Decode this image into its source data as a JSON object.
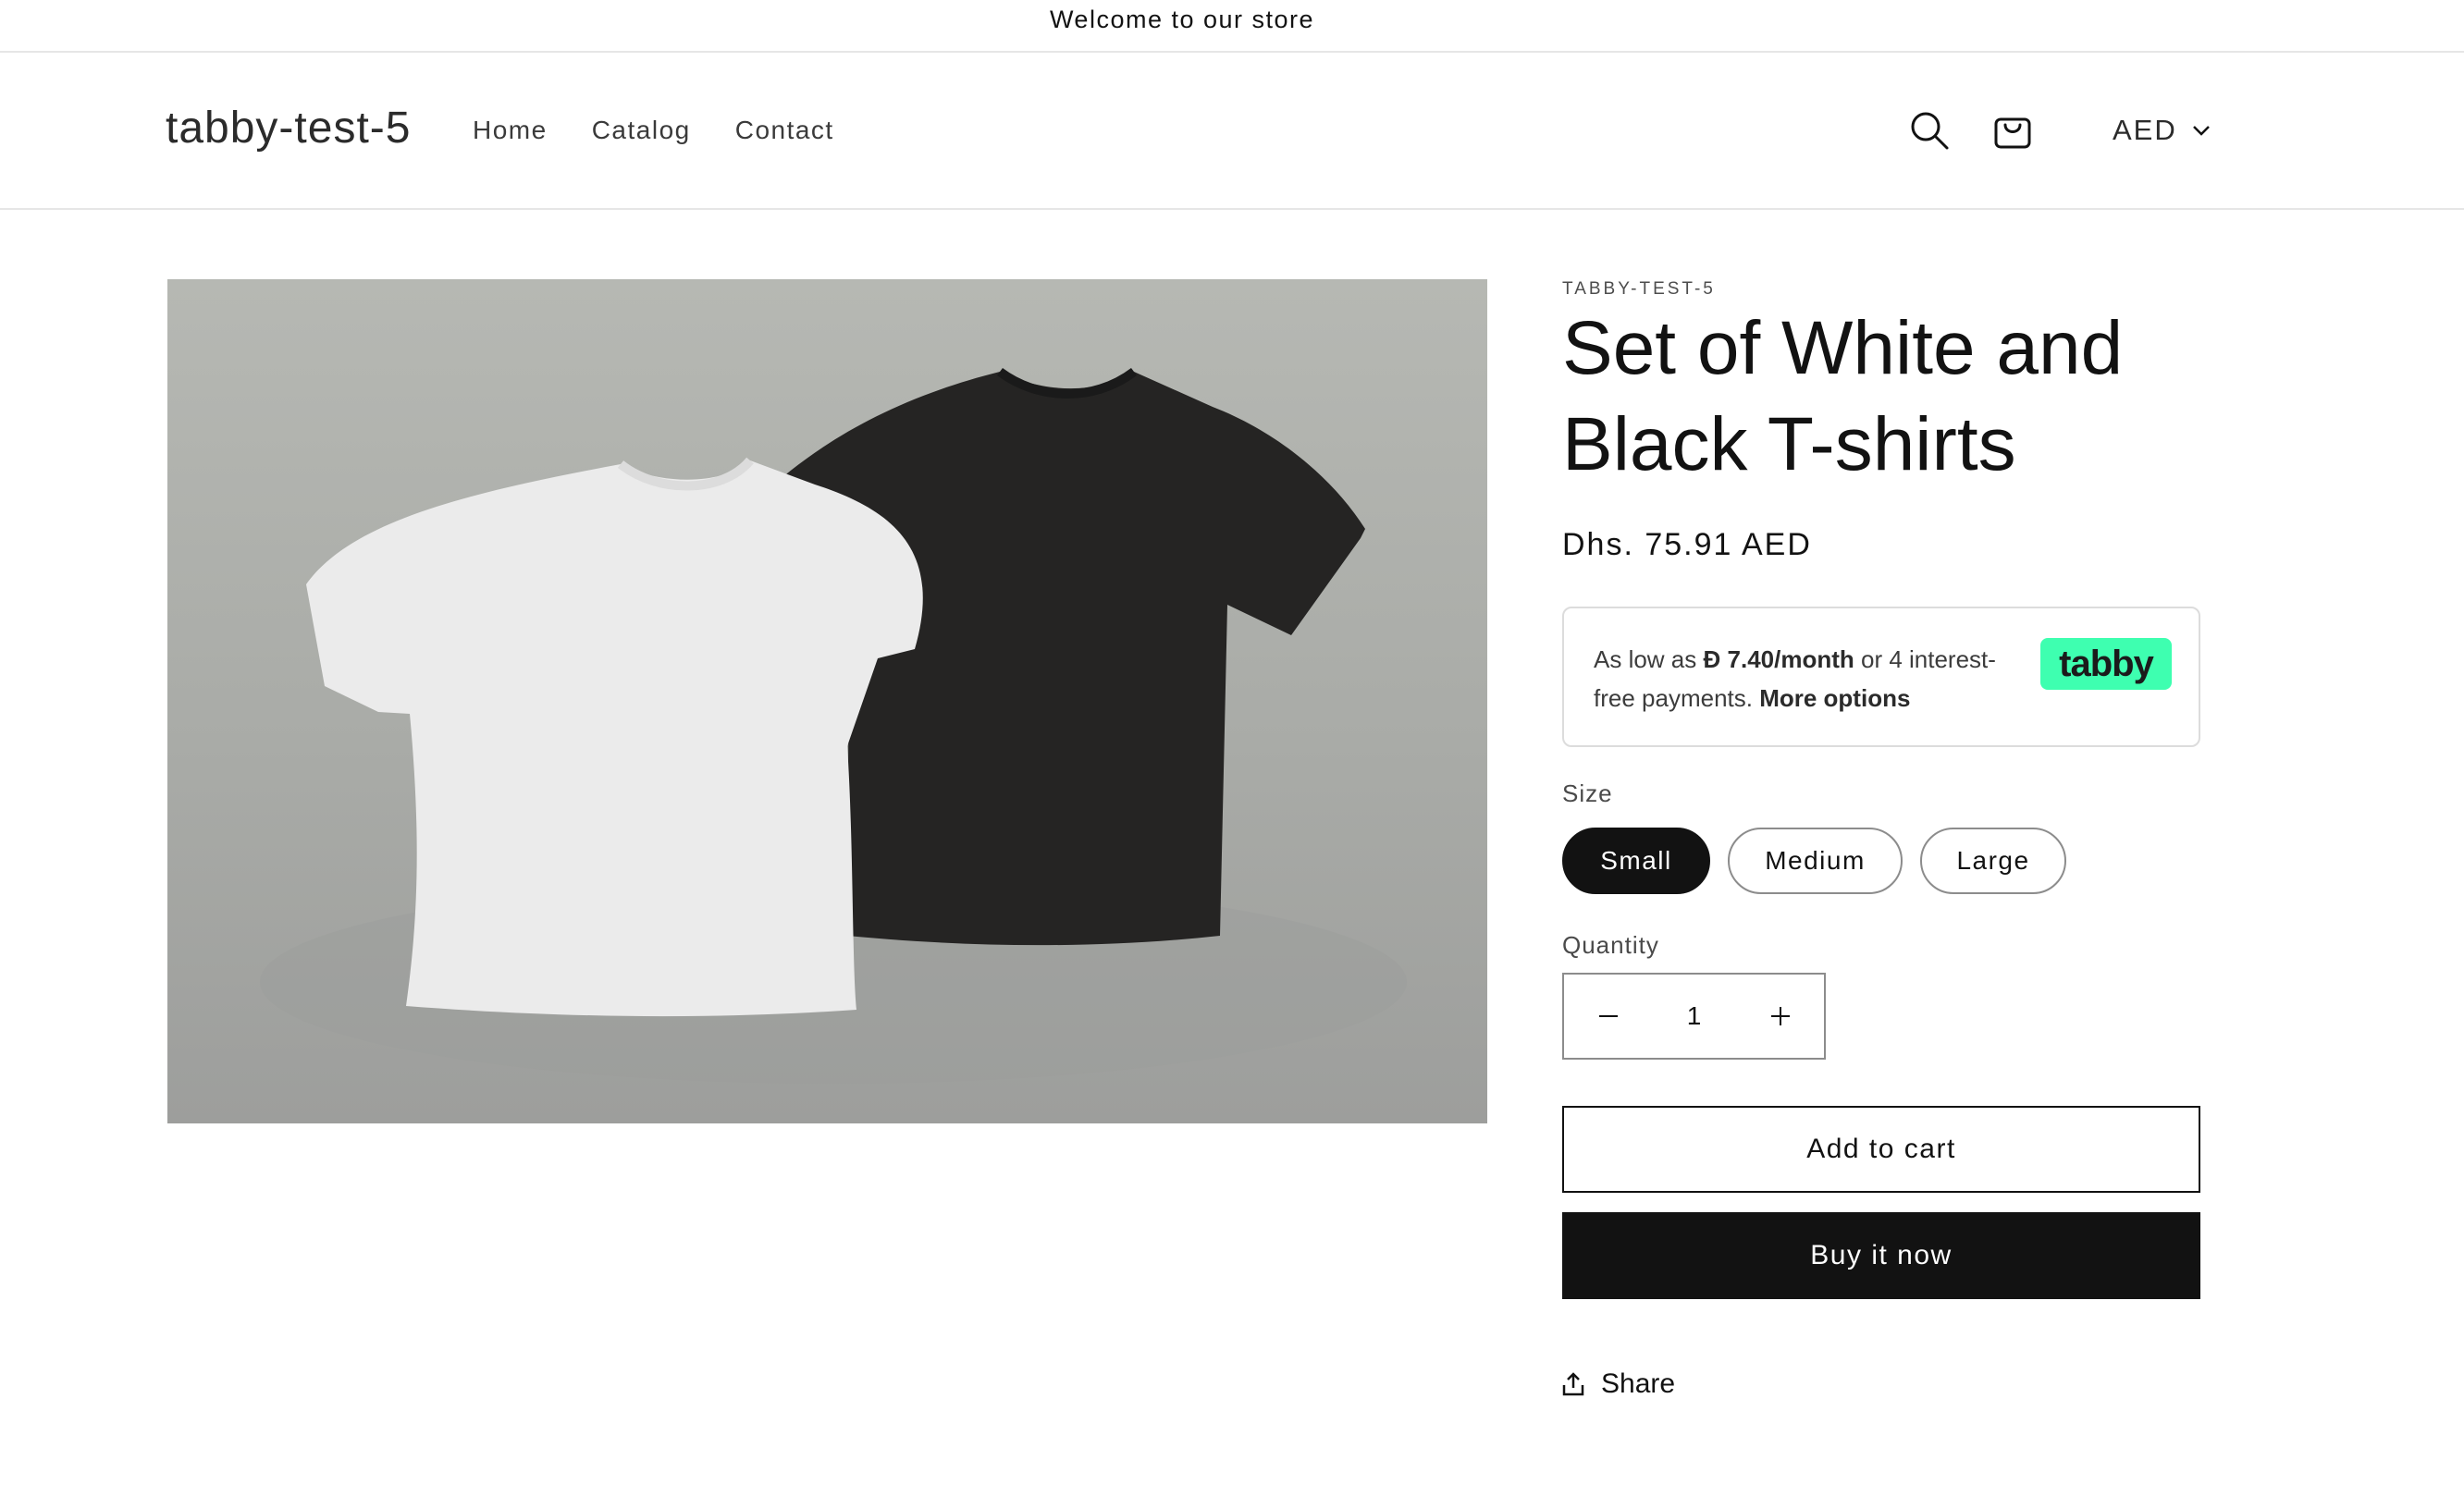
{
  "announcement": {
    "text": "Welcome to our store"
  },
  "header": {
    "logo": "tabby-test-5",
    "nav": [
      {
        "label": "Home"
      },
      {
        "label": "Catalog"
      },
      {
        "label": "Contact"
      }
    ],
    "icons": {
      "search": "search-icon",
      "cart": "cart-icon",
      "currency_chevron": "chevron-down-icon"
    },
    "currency": "AED"
  },
  "product": {
    "vendor": "TABBY-TEST-5",
    "title": "Set of White and Black T-shirts",
    "price": "Dhs. 75.91 AED",
    "tabby": {
      "prefix": "As low as ",
      "currency_symbol": "Đ",
      "amount": " 7.40/month",
      "suffix": " or 4 interest-free payments. ",
      "more": "More options",
      "logo": "tabby",
      "logo_color": "#3EFFB0"
    },
    "size_label": "Size",
    "sizes": [
      {
        "label": "Small",
        "selected": true
      },
      {
        "label": "Medium",
        "selected": false
      },
      {
        "label": "Large",
        "selected": false
      }
    ],
    "quantity_label": "Quantity",
    "quantity": "1",
    "add_to_cart": "Add to cart",
    "buy_now": "Buy it now",
    "share": "Share"
  },
  "colors": {
    "text": "#121212",
    "border": "#E6E6E6",
    "button_dark": "#121212"
  }
}
